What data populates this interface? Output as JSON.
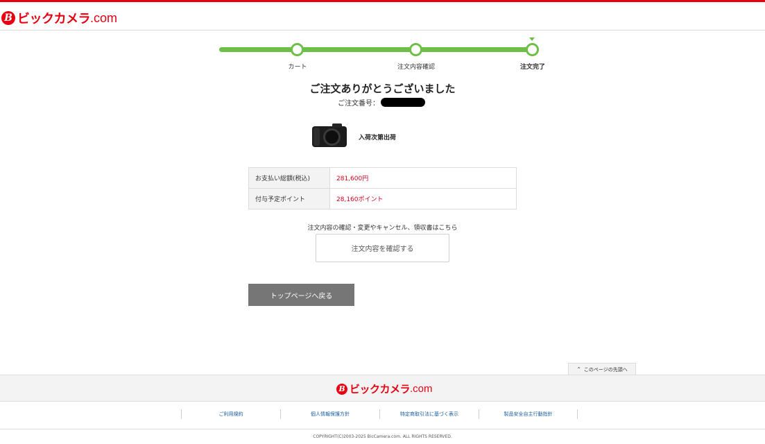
{
  "brand": {
    "mark": "B",
    "name": "ビックカメラ",
    "suffix": ".com",
    "color": "#e60012"
  },
  "progress": {
    "steps": [
      {
        "label": "カート"
      },
      {
        "label": "注文内容確認"
      },
      {
        "label": "注文完了"
      }
    ],
    "current_step": 3,
    "color": "#6dbf47"
  },
  "confirmation": {
    "title": "ご注文ありがとうございました",
    "order_number_label": "ご注文番号："
  },
  "product": {
    "image_icon": "camera-icon",
    "status": "入荷次第出荷"
  },
  "summary": {
    "rows": [
      {
        "label": "お支払い総額(税込)",
        "value": "281,600円"
      },
      {
        "label": "付与予定ポイント",
        "value": "28,160ポイント"
      }
    ],
    "value_color": "#d0021b"
  },
  "order_actions": {
    "note": "注文内容の確認・変更やキャンセル、領収書はこちら",
    "confirm_button": "注文内容を確認する",
    "back_button": "トップページへ戻る"
  },
  "page_top": {
    "label": "このページの先頭へ",
    "icon": "chevron-up-icon"
  },
  "footer": {
    "links": [
      "ご利用規約",
      "個人情報保護方針",
      "特定商取引法に基づく表示",
      "製品安全自主行動指針"
    ],
    "copyright": "COPYRIGHT(C)2003-2025 BicCamera.com. ALL RIGHTS RESERVED."
  }
}
